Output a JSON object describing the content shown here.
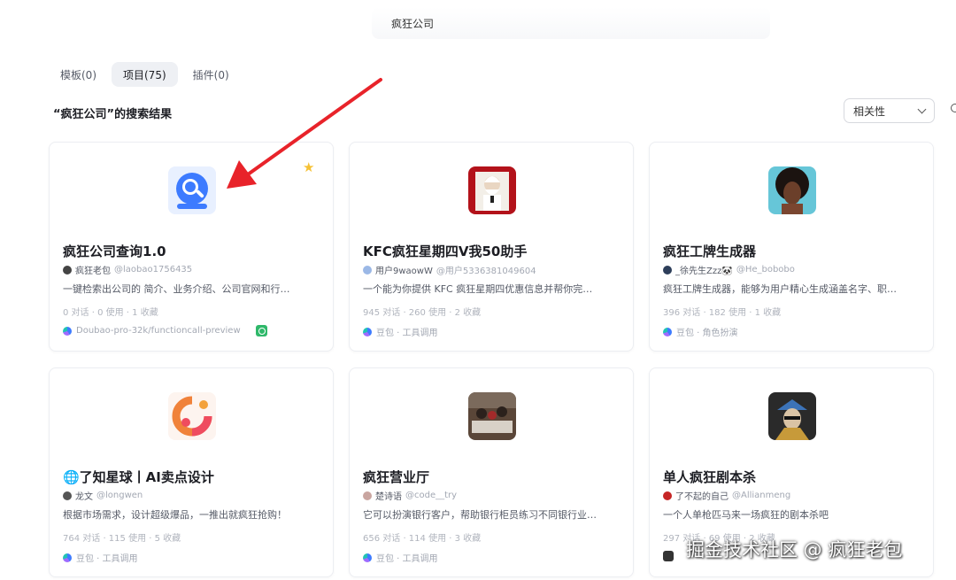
{
  "search": {
    "query": "疯狂公司"
  },
  "tabs": [
    {
      "label": "模板(0)",
      "active": false
    },
    {
      "label": "项目(75)",
      "active": true
    },
    {
      "label": "插件(0)",
      "active": false
    }
  ],
  "result_heading": "“疯狂公司”的搜索结果",
  "sort": {
    "selected": "相关性"
  },
  "cards": [
    {
      "title": "疯狂公司查询1.0",
      "author": "疯狂老包",
      "handle": "@laobao1756435",
      "description": "一键检索出公司的 简介、业务介绍、公司官网和行…",
      "stats": "0 对话 · 0 使用 · 1 收藏",
      "model": "Doubao-pro-32k/functioncall-preview",
      "starred": true
    },
    {
      "title": "KFC疯狂星期四V我50助手",
      "author": "用户9waowW",
      "handle": "@用户5336381049604",
      "description": "一个能为你提供 KFC 疯狂星期四优惠信息并帮你完…",
      "stats": "945 对话 · 260 使用 · 2 收藏",
      "model": "豆包 · 工具调用"
    },
    {
      "title": "疯狂工牌生成器",
      "author": "_徐先生Zzz🐼",
      "handle": "@He_bobobo",
      "description": "疯狂工牌生成器，能够为用户精心生成涵盖名字、职…",
      "stats": "396 对话 · 182 使用 · 1 收藏",
      "model": "豆包 · 角色扮演"
    },
    {
      "title": "🌐了知星球丨AI卖点设计",
      "author": "龙文",
      "handle": "@longwen",
      "description": "根据市场需求，设计超级爆品，一推出就疯狂抢购！",
      "stats": "764 对话 · 115 使用 · 5 收藏",
      "model": "豆包 · 工具调用"
    },
    {
      "title": "疯狂营业厅",
      "author": "楚诗语",
      "handle": "@code__try",
      "description": "它可以扮演银行客户，帮助银行柜员练习不同银行业…",
      "stats": "656 对话 · 114 使用 · 3 收藏",
      "model": "豆包 · 工具调用"
    },
    {
      "title": "单人疯狂剧本杀",
      "author": "了不起的自己",
      "handle": "@Allianmeng",
      "description": "一个人单枪匹马来一场疯狂的剧本杀吧",
      "stats": "297 对话 · 69 使用 · 2 收藏",
      "model": ""
    }
  ],
  "watermark": "掘金技术社区 @ 疯狂老包",
  "colors": {
    "accent": "#3d7bff",
    "star": "#f6c134",
    "arrow": "#e8232a",
    "badge": "#2fb86a"
  }
}
